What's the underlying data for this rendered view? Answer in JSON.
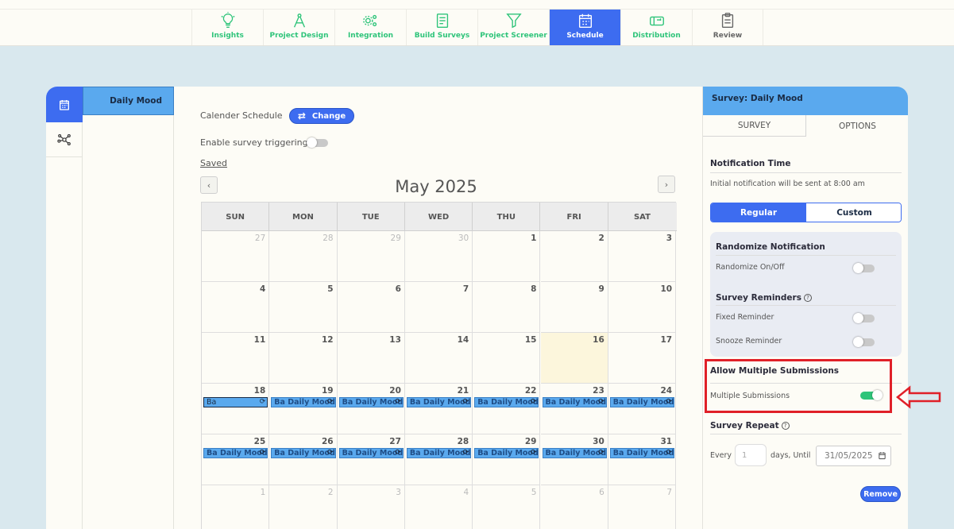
{
  "nav": {
    "items": [
      {
        "label": "Insights",
        "icon": "lightbulb-icon"
      },
      {
        "label": "Project Design",
        "icon": "compass-icon"
      },
      {
        "label": "Integration",
        "icon": "gears-icon"
      },
      {
        "label": "Build Surveys",
        "icon": "form-icon"
      },
      {
        "label": "Project Screener",
        "icon": "filter-icon"
      },
      {
        "label": "Schedule",
        "icon": "calendar-icon",
        "active": true
      },
      {
        "label": "Distribution",
        "icon": "mailbox-icon"
      },
      {
        "label": "Review",
        "icon": "clipboard-icon"
      }
    ]
  },
  "sidebar": {
    "survey_name": "Daily Mood"
  },
  "schedule": {
    "calendar_label": "Calender Schedule",
    "change_button": "Change",
    "trigger_label": "Enable survey triggering",
    "saved_label": "Saved",
    "month_title": "May 2025",
    "prev_label": "‹",
    "next_label": "›",
    "day_names": [
      "SUN",
      "MON",
      "TUE",
      "WED",
      "THU",
      "FRI",
      "SAT"
    ],
    "weeks": [
      [
        {
          "d": "27",
          "o": true
        },
        {
          "d": "28",
          "o": true
        },
        {
          "d": "29",
          "o": true
        },
        {
          "d": "30",
          "o": true
        },
        {
          "d": "1"
        },
        {
          "d": "2"
        },
        {
          "d": "3"
        }
      ],
      [
        {
          "d": "4"
        },
        {
          "d": "5"
        },
        {
          "d": "6"
        },
        {
          "d": "7"
        },
        {
          "d": "8"
        },
        {
          "d": "9"
        },
        {
          "d": "10"
        }
      ],
      [
        {
          "d": "11"
        },
        {
          "d": "12"
        },
        {
          "d": "13"
        },
        {
          "d": "14"
        },
        {
          "d": "15"
        },
        {
          "d": "16",
          "today": true
        },
        {
          "d": "17"
        }
      ],
      [
        {
          "d": "18",
          "e": "Ba",
          "sel": true
        },
        {
          "d": "19",
          "e": "Ba Daily Mood"
        },
        {
          "d": "20",
          "e": "Ba Daily Mood"
        },
        {
          "d": "21",
          "e": "Ba Daily Mood"
        },
        {
          "d": "22",
          "e": "Ba Daily Mood"
        },
        {
          "d": "23",
          "e": "Ba Daily Mood"
        },
        {
          "d": "24",
          "e": "Ba Daily Mood"
        }
      ],
      [
        {
          "d": "25",
          "e": "Ba Daily Mood"
        },
        {
          "d": "26",
          "e": "Ba Daily Mood"
        },
        {
          "d": "27",
          "e": "Ba Daily Mood"
        },
        {
          "d": "28",
          "e": "Ba Daily Mood"
        },
        {
          "d": "29",
          "e": "Ba Daily Mood"
        },
        {
          "d": "30",
          "e": "Ba Daily Mood"
        },
        {
          "d": "31",
          "e": "Ba Daily Mood"
        }
      ],
      [
        {
          "d": "1",
          "o": true
        },
        {
          "d": "2",
          "o": true
        },
        {
          "d": "3",
          "o": true
        },
        {
          "d": "4",
          "o": true
        },
        {
          "d": "5",
          "o": true
        },
        {
          "d": "6",
          "o": true
        },
        {
          "d": "7",
          "o": true
        }
      ]
    ]
  },
  "right_panel": {
    "header": "Survey: Daily Mood",
    "tab_survey": "SURVEY",
    "tab_options": "OPTIONS",
    "notification_title": "Notification Time",
    "notification_text": "Initial notification will be sent at 8:00 am",
    "seg_regular": "Regular",
    "seg_custom": "Custom",
    "randomize_title": "Randomize Notification",
    "randomize_label": "Randomize On/Off",
    "reminders_title": "Survey Reminders",
    "fixed_label": "Fixed Reminder",
    "snooze_label": "Snooze Reminder",
    "multiple_title": "Allow Multiple Submissions",
    "multiple_label": "Multiple Submissions",
    "repeat_title": "Survey Repeat",
    "every_label": "Every",
    "every_placeholder": "1",
    "days_until_label": "days, Until",
    "until_date": "31/05/2025",
    "remove_button": "Remove",
    "qmark": "?"
  },
  "colors": {
    "accent": "#3d6cf0",
    "green": "#2ec47a",
    "event": "#5aa9ee",
    "highlight": "#e02028"
  }
}
